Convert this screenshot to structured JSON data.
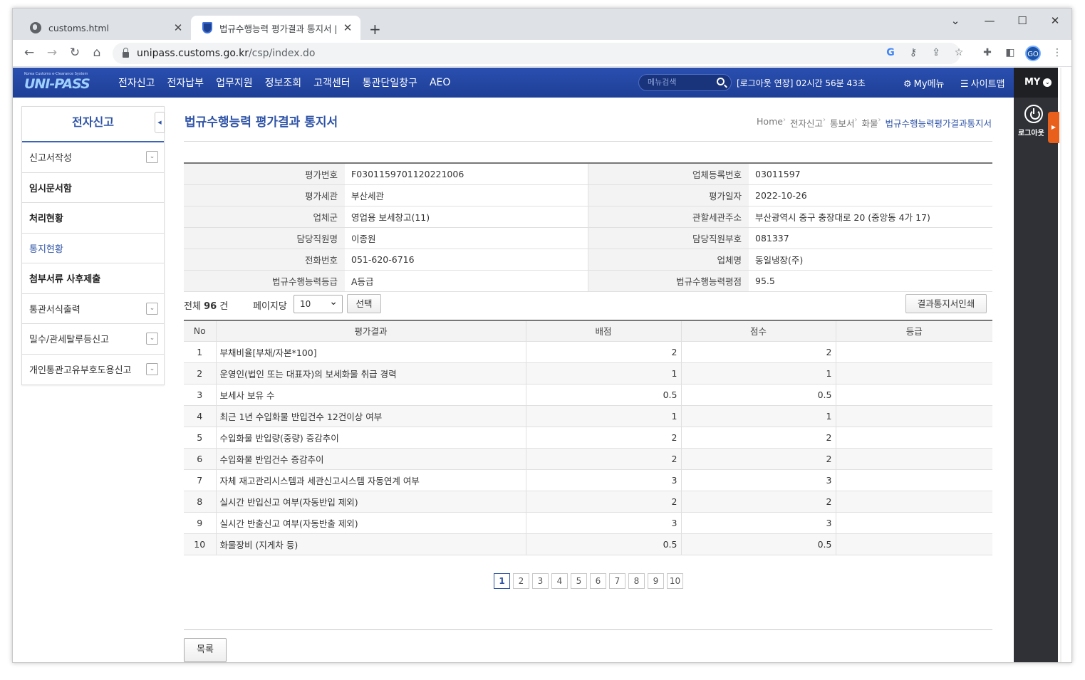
{
  "browser": {
    "tabs": [
      {
        "title": "customs.html"
      },
      {
        "title": "법규수행능력 평가결과 통지서 |"
      }
    ],
    "url_domain": "unipass.customs.go.kr",
    "url_path": "/csp/index.do",
    "profile_initials": "GO"
  },
  "header": {
    "logo_small": "Korea Customs e-Clearance System",
    "logo_main": "UNI-PASS",
    "menu": [
      "전자신고",
      "전자납부",
      "업무지원",
      "정보조회",
      "고객센터",
      "통관단일창구",
      "AEO"
    ],
    "search_placeholder": "메뉴검색",
    "logout_timer": "[로그아웃 연장] 02시간 56분 43초",
    "mymenu_label": "My메뉴",
    "sitemap_label": "사이트맵",
    "my_label": "MY",
    "logout_label": "로그아웃"
  },
  "sidebar": {
    "title": "전자신고",
    "items": [
      {
        "label": "신고서작성",
        "style": "normal",
        "expandable": true
      },
      {
        "label": "임시문서함",
        "style": "bold",
        "expandable": false
      },
      {
        "label": "처리현황",
        "style": "bold",
        "expandable": false
      },
      {
        "label": "통지현황",
        "style": "active",
        "expandable": false
      },
      {
        "label": "첨부서류 사후제출",
        "style": "bold",
        "expandable": false
      },
      {
        "label": "통관서식출력",
        "style": "normal",
        "expandable": true
      },
      {
        "label": "밀수/관세탈루등신고",
        "style": "normal",
        "expandable": true
      },
      {
        "label": "개인통관고유부호도용신고",
        "style": "normal",
        "expandable": true
      }
    ]
  },
  "page": {
    "title": "법규수행능력 평가결과 통지서",
    "breadcrumb": [
      "Home",
      "전자신고",
      "통보서",
      "화물",
      "법규수행능력평가결과통지서"
    ]
  },
  "info": {
    "rows": [
      [
        {
          "label": "평가번호",
          "value": "F0301159701120221006"
        },
        {
          "label": "업체등록번호",
          "value": "03011597"
        }
      ],
      [
        {
          "label": "평가세관",
          "value": "부산세관"
        },
        {
          "label": "평가일자",
          "value": "2022-10-26"
        }
      ],
      [
        {
          "label": "업체군",
          "value": "영업용 보세창고(11)"
        },
        {
          "label": "관할세관주소",
          "value": "부산광역시 중구 충장대로 20 (중앙동 4가 17)"
        }
      ],
      [
        {
          "label": "담당직원명",
          "value": "이종원"
        },
        {
          "label": "담당직원부호",
          "value": "081337"
        }
      ],
      [
        {
          "label": "전화번호",
          "value": "051-620-6716"
        },
        {
          "label": "업체명",
          "value": "동일냉장(주)"
        }
      ],
      [
        {
          "label": "법규수행능력등급",
          "value": "A등급"
        },
        {
          "label": "법규수행능력평점",
          "value": "95.5"
        }
      ]
    ]
  },
  "list": {
    "total_prefix": "전체",
    "total_count": "96",
    "total_suffix": "건",
    "per_page_label": "페이지당",
    "per_page_value": "10",
    "select_button": "선택",
    "print_button": "결과통지서인쇄",
    "columns": [
      "No",
      "평가결과",
      "배점",
      "점수",
      "등급"
    ],
    "rows": [
      [
        "1",
        "부채비율[부채/자본*100]",
        "2",
        "2",
        ""
      ],
      [
        "2",
        "운영인(법인 또는 대표자)의 보세화물 취급 경력",
        "1",
        "1",
        ""
      ],
      [
        "3",
        "보세사 보유 수",
        "0.5",
        "0.5",
        ""
      ],
      [
        "4",
        "최근 1년 수입화물 반입건수 12건이상 여부",
        "1",
        "1",
        ""
      ],
      [
        "5",
        "수입화물 반입량(중량) 증감추이",
        "2",
        "2",
        ""
      ],
      [
        "6",
        "수입화물 반입건수 증감추이",
        "2",
        "2",
        ""
      ],
      [
        "7",
        "자체 재고관리시스템과 세관신고시스템 자동연계 여부",
        "3",
        "3",
        ""
      ],
      [
        "8",
        "실시간 반입신고 여부(자동반입 제외)",
        "2",
        "2",
        ""
      ],
      [
        "9",
        "실시간 반출신고 여부(자동반출 제외)",
        "3",
        "3",
        ""
      ],
      [
        "10",
        "화물장비 (지게차 등)",
        "0.5",
        "0.5",
        ""
      ]
    ],
    "pages": [
      "1",
      "2",
      "3",
      "4",
      "5",
      "6",
      "7",
      "8",
      "9",
      "10"
    ],
    "current_page": "1"
  },
  "footer": {
    "list_button": "목록"
  },
  "colors": {
    "header_blue": "#1e3f96",
    "title_blue": "#2f54a7",
    "quick_panel": "#2f3136",
    "accent_orange": "#e8601c"
  }
}
